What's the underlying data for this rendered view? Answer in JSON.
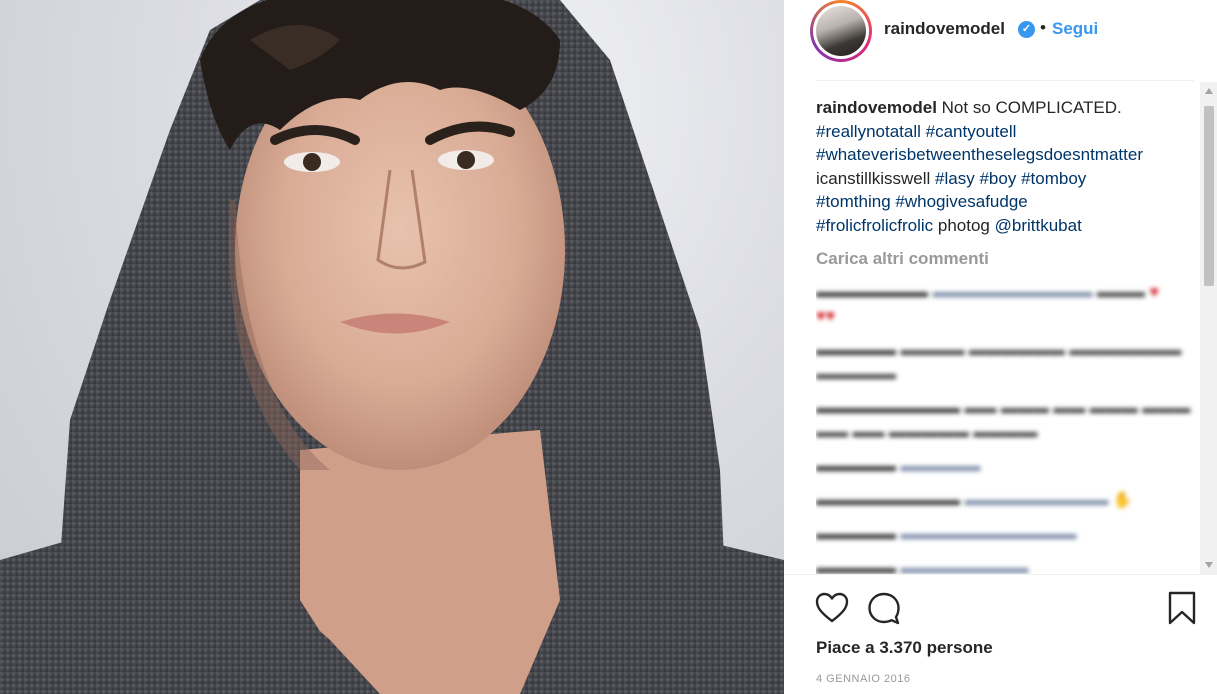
{
  "post": {
    "username": "raindovemodel",
    "verified_icon": "verified-badge-icon",
    "separator": "•",
    "follow_label": "Segui",
    "caption": {
      "username": "raindovemodel",
      "text": "Not so COMPLICATED.",
      "tags": [
        "#reallynotatall",
        "#cantyoutell",
        "#whateverisbetweentheselegsdoesntmatter",
        "icanstillkisswell",
        "#lasy",
        "#boy",
        "#tomboy",
        "#tomthing",
        "#whogivesafudge",
        "#frolicfrolicfrolic"
      ],
      "photog_text": "photog",
      "photog_handle": "@brittkubat"
    },
    "load_more_label": "Carica altri commenti",
    "likes_text": "Piace a 3.370 persone",
    "date": "4 GENNAIO 2016",
    "colors": {
      "link": "#003569",
      "accent": "#3897f0",
      "muted": "#999999"
    }
  }
}
